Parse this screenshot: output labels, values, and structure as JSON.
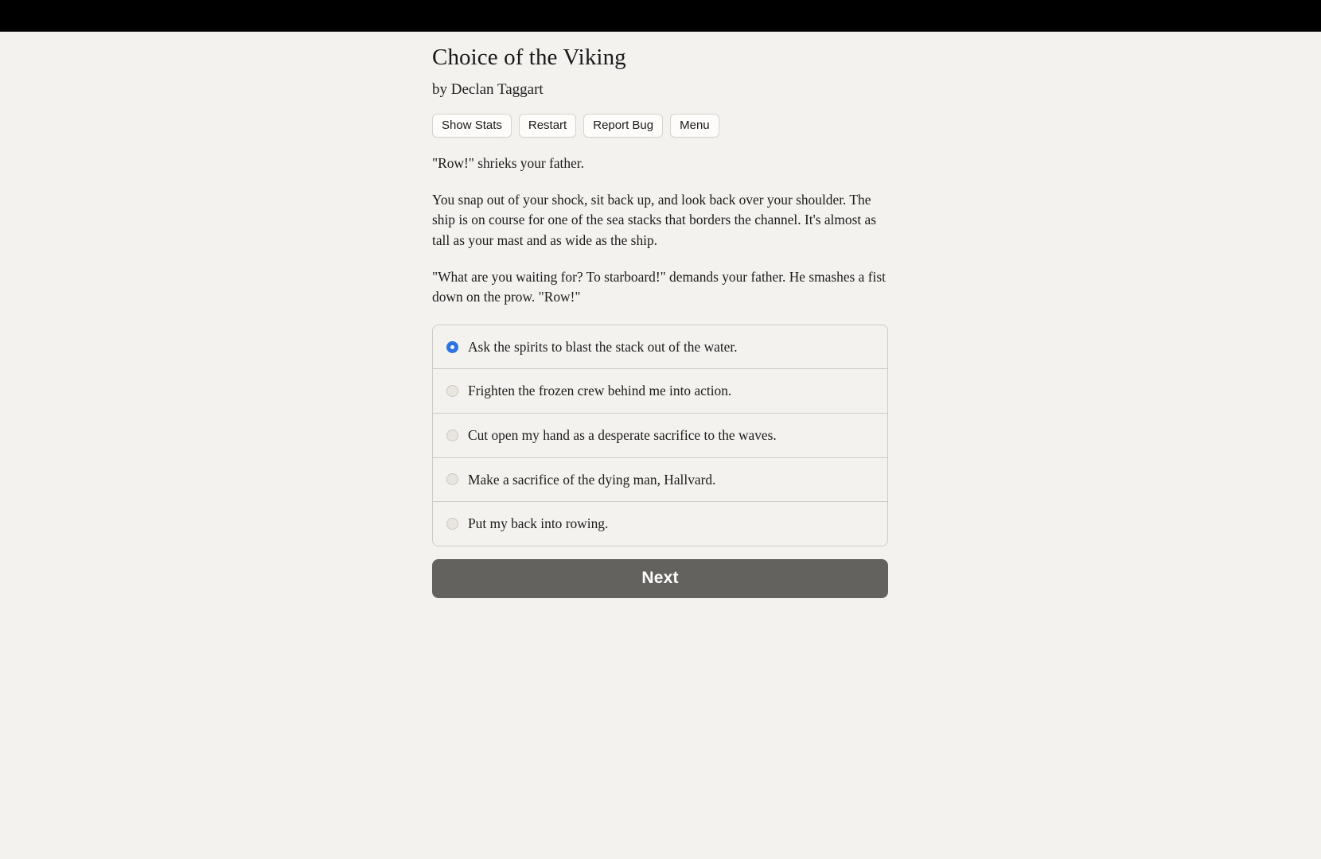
{
  "window": {
    "chrome_bar_color": "#000000",
    "page_background": "#f4f2ee"
  },
  "header": {
    "title": "Choice of the Viking",
    "byline": "by Declan Taggart"
  },
  "toolbar": {
    "buttons": [
      {
        "label": "Show Stats",
        "name": "show-stats-button"
      },
      {
        "label": "Restart",
        "name": "restart-button"
      },
      {
        "label": "Report Bug",
        "name": "report-bug-button"
      },
      {
        "label": "Menu",
        "name": "menu-button"
      }
    ]
  },
  "story": {
    "paragraphs": [
      "\"Row!\" shrieks your father.",
      "You snap out of your shock, sit back up, and look back over your shoulder. The ship is on course for one of the sea stacks that borders the channel. It's almost as tall as your mast and as wide as the ship.",
      "\"What are you waiting for? To starboard!\" demands your father. He smashes a fist down on the prow. \"Row!\""
    ]
  },
  "choices": {
    "selected_index": 0,
    "selected_color": "#2a74e8",
    "options": [
      {
        "label": "Ask the spirits to blast the stack out of the water.",
        "selected": true
      },
      {
        "label": "Frighten the frozen crew behind me into action.",
        "selected": false
      },
      {
        "label": "Cut open my hand as a desperate sacrifice to the waves.",
        "selected": false
      },
      {
        "label": "Make a sacrifice of the dying man, Hallvard.",
        "selected": false
      },
      {
        "label": "Put my back into rowing.",
        "selected": false
      }
    ]
  },
  "footer": {
    "next_label": "Next",
    "next_color": "#64625e"
  }
}
